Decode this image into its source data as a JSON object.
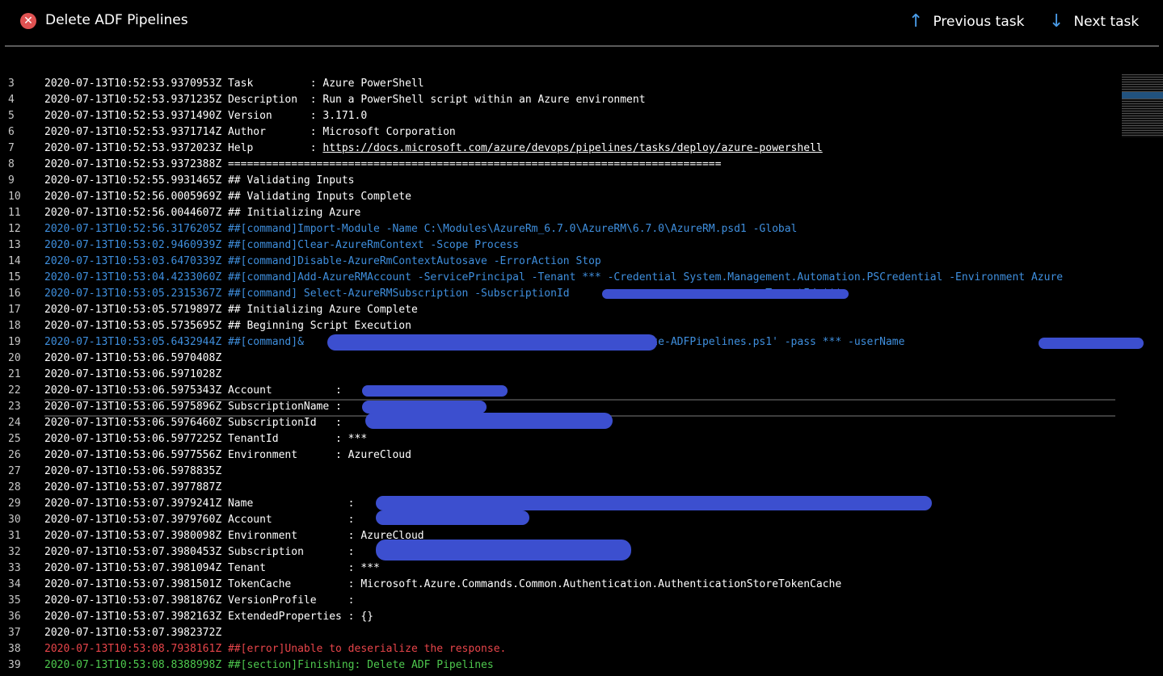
{
  "header": {
    "status_icon": "✕",
    "title": "Delete ADF Pipelines",
    "prev_label": "Previous task",
    "next_label": "Next task"
  },
  "log": [
    {
      "n": "3",
      "t": "2020-07-13T10:52:53.9370953Z Task         : Azure PowerShell",
      "kind": "plain"
    },
    {
      "n": "4",
      "t": "2020-07-13T10:52:53.9371235Z Description  : Run a PowerShell script within an Azure environment",
      "kind": "plain"
    },
    {
      "n": "5",
      "t": "2020-07-13T10:52:53.9371490Z Version      : 3.171.0",
      "kind": "plain"
    },
    {
      "n": "6",
      "t": "2020-07-13T10:52:53.9371714Z Author       : Microsoft Corporation",
      "kind": "plain"
    },
    {
      "n": "7",
      "t": "2020-07-13T10:52:53.9372023Z Help         : ",
      "link": "https://docs.microsoft.com/azure/devops/pipelines/tasks/deploy/azure-powershell",
      "kind": "plain"
    },
    {
      "n": "8",
      "t": "2020-07-13T10:52:53.9372388Z ==============================================================================",
      "kind": "plain"
    },
    {
      "n": "9",
      "t": "2020-07-13T10:52:55.9931465Z ## Validating Inputs",
      "kind": "plain"
    },
    {
      "n": "10",
      "t": "2020-07-13T10:52:56.0005969Z ## Validating Inputs Complete",
      "kind": "plain"
    },
    {
      "n": "11",
      "t": "2020-07-13T10:52:56.0044607Z ## Initializing Azure",
      "kind": "plain"
    },
    {
      "n": "12",
      "t": "2020-07-13T10:52:56.3176205Z ##[command]Import-Module -Name C:\\Modules\\AzureRm_6.7.0\\AzureRM\\6.7.0\\AzureRM.psd1 -Global",
      "kind": "cmd"
    },
    {
      "n": "13",
      "t": "2020-07-13T10:53:02.9460939Z ##[command]Clear-AzureRmContext -Scope Process",
      "kind": "cmd"
    },
    {
      "n": "14",
      "t": "2020-07-13T10:53:03.6470339Z ##[command]Disable-AzureRmContextAutosave -ErrorAction Stop",
      "kind": "cmd"
    },
    {
      "n": "15",
      "t": "2020-07-13T10:53:04.4233060Z ##[command]Add-AzureRMAccount -ServicePrincipal -Tenant *** -Credential System.Management.Automation.PSCredential -Environment Azure",
      "kind": "cmd"
    },
    {
      "n": "16",
      "t": "2020-07-13T10:53:05.2315367Z ##[command] Select-AzureRMSubscription -SubscriptionId                              -TenantId ***",
      "kind": "cmd"
    },
    {
      "n": "17",
      "t": "2020-07-13T10:53:05.5719897Z ## Initializing Azure Complete",
      "kind": "plain"
    },
    {
      "n": "18",
      "t": "2020-07-13T10:53:05.5735695Z ## Beginning Script Execution",
      "kind": "plain"
    },
    {
      "n": "19",
      "t": "2020-07-13T10:53:05.6432944Z ##[command]&                                       \\PowerShell\\Delete-ADFPipelines.ps1' -pass *** -userName",
      "kind": "cmd"
    },
    {
      "n": "20",
      "t": "2020-07-13T10:53:06.5970408Z",
      "kind": "plain"
    },
    {
      "n": "21",
      "t": "2020-07-13T10:53:06.5971028Z",
      "kind": "plain"
    },
    {
      "n": "22",
      "t": "2020-07-13T10:53:06.5975343Z Account          :",
      "kind": "plain"
    },
    {
      "n": "23",
      "t": "2020-07-13T10:53:06.5975896Z SubscriptionName :",
      "kind": "plain"
    },
    {
      "n": "24",
      "t": "2020-07-13T10:53:06.5976460Z SubscriptionId   :",
      "kind": "plain"
    },
    {
      "n": "25",
      "t": "2020-07-13T10:53:06.5977225Z TenantId         : ***",
      "kind": "plain"
    },
    {
      "n": "26",
      "t": "2020-07-13T10:53:06.5977556Z Environment      : AzureCloud",
      "kind": "plain"
    },
    {
      "n": "27",
      "t": "2020-07-13T10:53:06.5978835Z",
      "kind": "plain"
    },
    {
      "n": "28",
      "t": "2020-07-13T10:53:07.3977887Z",
      "kind": "plain"
    },
    {
      "n": "29",
      "t": "2020-07-13T10:53:07.3979241Z Name               :",
      "kind": "plain"
    },
    {
      "n": "30",
      "t": "2020-07-13T10:53:07.3979760Z Account            :",
      "kind": "plain"
    },
    {
      "n": "31",
      "t": "2020-07-13T10:53:07.3980098Z Environment        : AzureCloud",
      "kind": "plain"
    },
    {
      "n": "32",
      "t": "2020-07-13T10:53:07.3980453Z Subscription       :",
      "kind": "plain"
    },
    {
      "n": "33",
      "t": "2020-07-13T10:53:07.3981094Z Tenant             : ***",
      "kind": "plain"
    },
    {
      "n": "34",
      "t": "2020-07-13T10:53:07.3981501Z TokenCache         : Microsoft.Azure.Commands.Common.Authentication.AuthenticationStoreTokenCache",
      "kind": "plain"
    },
    {
      "n": "35",
      "t": "2020-07-13T10:53:07.3981876Z VersionProfile     :",
      "kind": "plain"
    },
    {
      "n": "36",
      "t": "2020-07-13T10:53:07.3982163Z ExtendedProperties : {}",
      "kind": "plain"
    },
    {
      "n": "37",
      "t": "2020-07-13T10:53:07.3982372Z",
      "kind": "plain"
    },
    {
      "n": "38",
      "t": "2020-07-13T10:53:08.7938161Z ##[error]Unable to deserialize the response.",
      "kind": "err"
    },
    {
      "n": "39",
      "t": "2020-07-13T10:53:08.8388998Z ##[section]Finishing: Delete ADF Pipelines",
      "kind": "sec"
    }
  ],
  "colors": {
    "command": "#3f8fde",
    "error": "#e8454a",
    "section": "#4ec94e",
    "redaction": "#3c4fcf"
  }
}
